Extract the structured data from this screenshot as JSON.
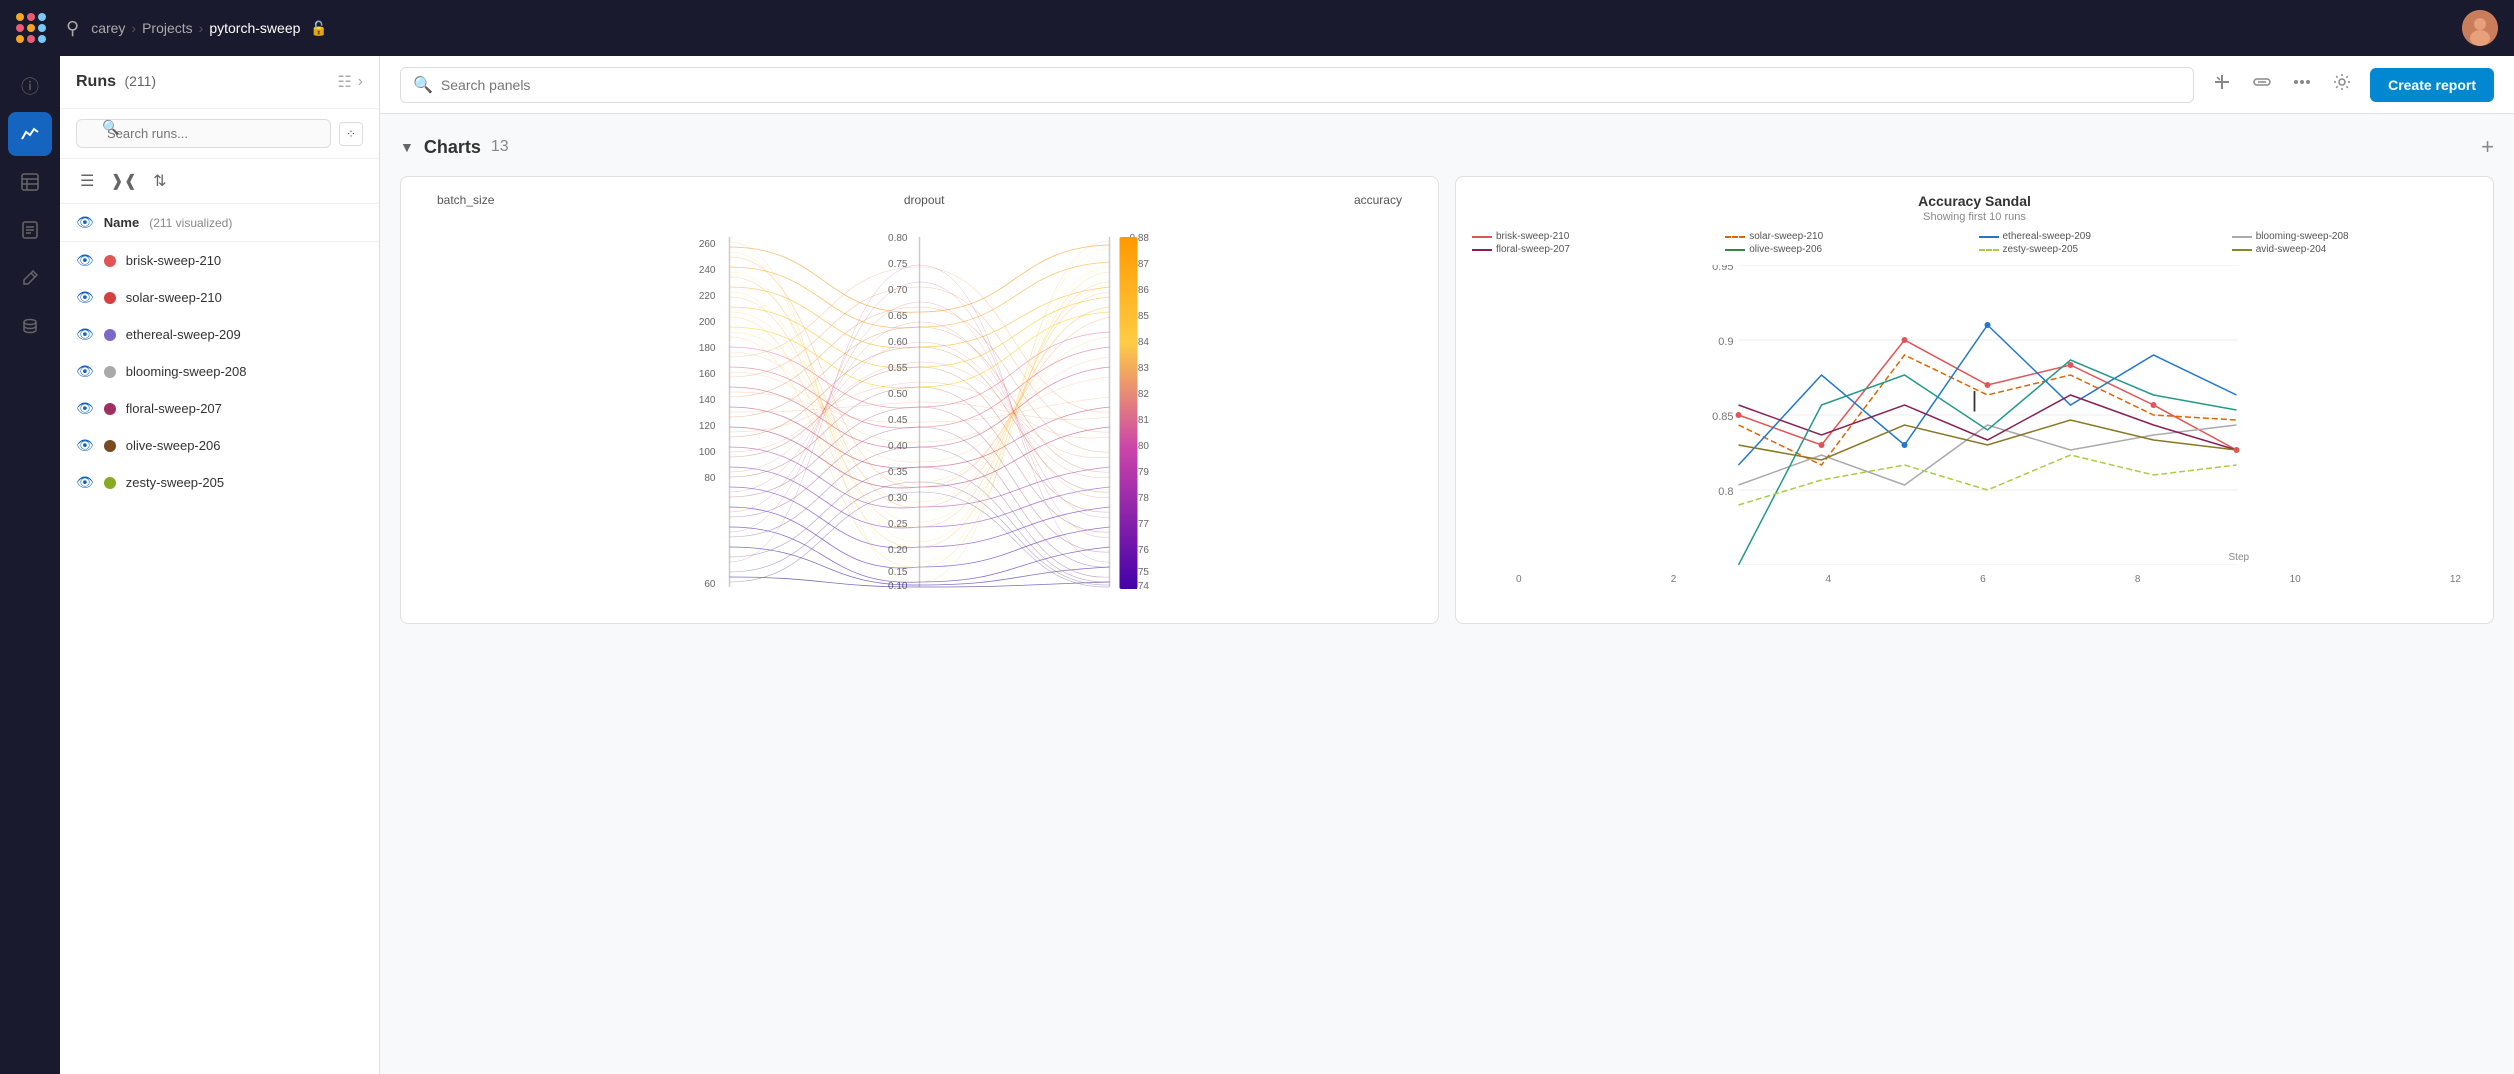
{
  "topnav": {
    "breadcrumb": {
      "user": "carey",
      "project": "Projects",
      "repo": "pytorch-sweep"
    },
    "search_placeholder": "Search panels"
  },
  "sidebar": {
    "title": "Runs",
    "run_count": "(211)",
    "name_header": "Name",
    "name_subtext": "(211 visualized)",
    "runs": [
      {
        "name": "brisk-sweep-210",
        "color": "#e05555"
      },
      {
        "name": "solar-sweep-210",
        "color": "#d44040"
      },
      {
        "name": "ethereal-sweep-209",
        "color": "#7b68c8"
      },
      {
        "name": "blooming-sweep-208",
        "color": "#aaaaaa"
      },
      {
        "name": "floral-sweep-207",
        "color": "#a03060"
      },
      {
        "name": "olive-sweep-206",
        "color": "#7a4a20"
      },
      {
        "name": "zesty-sweep-205",
        "color": "#88aa22"
      }
    ]
  },
  "charts": {
    "section_title": "Charts",
    "section_count": "13",
    "parallel_chart": {
      "axes": [
        "batch_size",
        "dropout",
        "accuracy"
      ],
      "y_values_batch": [
        "260",
        "240",
        "220",
        "200",
        "180",
        "160",
        "140",
        "120",
        "100",
        "80",
        "60"
      ],
      "y_values_dropout": [
        "0.80",
        "0.75",
        "0.70",
        "0.65",
        "0.60",
        "0.55",
        "0.50",
        "0.45",
        "0.40",
        "0.35",
        "0.30",
        "0.25",
        "0.20",
        "0.15",
        "0.10"
      ],
      "y_values_accuracy": [
        "0.88",
        "0.87",
        "0.86",
        "0.85",
        "0.84",
        "0.83",
        "0.82",
        "0.81",
        "0.80",
        "0.79",
        "0.78",
        "0.77",
        "0.76",
        "0.75",
        "0.74"
      ]
    },
    "accuracy_chart": {
      "title": "Accuracy Sandal",
      "subtitle": "Showing first 10 runs",
      "legend": [
        {
          "name": "brisk-sweep-210",
          "color": "#e05555",
          "style": "solid"
        },
        {
          "name": "solar-sweep-210",
          "color": "#dd6600",
          "style": "dashed"
        },
        {
          "name": "ethereal-sweep-209",
          "color": "#2277cc",
          "style": "solid"
        },
        {
          "name": "blooming-sweep-208",
          "color": "#aaaaaa",
          "style": "solid"
        },
        {
          "name": "floral-sweep-207",
          "color": "#882255",
          "style": "solid"
        },
        {
          "name": "olive-sweep-206",
          "color": "#338844",
          "style": "solid"
        },
        {
          "name": "zesty-sweep-205",
          "color": "#aacc44",
          "style": "dashed"
        },
        {
          "name": "avid-sweep-204",
          "color": "#888822",
          "style": "solid"
        }
      ],
      "y_labels": [
        "0.95",
        "0.9",
        "0.85",
        "0.8"
      ],
      "x_labels": [
        "0",
        "2",
        "4",
        "6",
        "8",
        "10",
        "12"
      ],
      "x_axis_title": "Step"
    }
  },
  "toolbar": {
    "create_report": "Create report"
  }
}
